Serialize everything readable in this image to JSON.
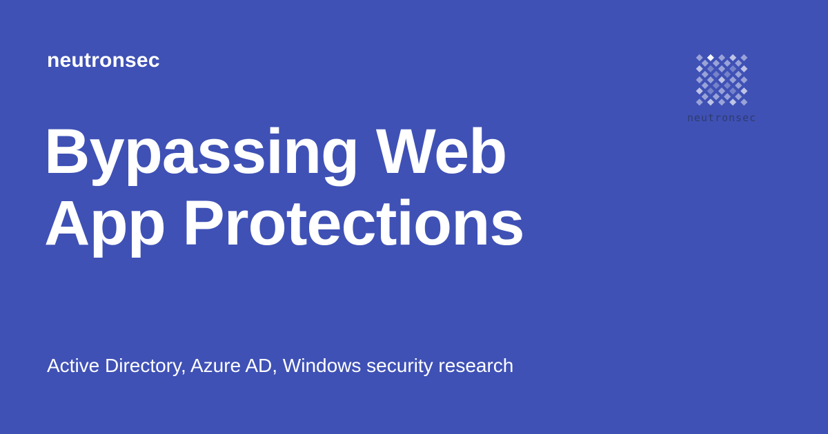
{
  "site": {
    "name": "neutronsec"
  },
  "post": {
    "title_line1": "Bypassing Web",
    "title_line2": "App Protections",
    "description": "Active Directory, Azure AD, Windows security research"
  },
  "logo": {
    "icon": "diamond-grid-icon",
    "wordmark": "neutronsec"
  },
  "colors": {
    "background": "#3f51b5",
    "text": "#ffffff",
    "logo_light": "#c5cae9",
    "logo_mid": "#9fa8da",
    "logo_dark": "#7986cb",
    "wordmark": "#2f3b6e"
  }
}
